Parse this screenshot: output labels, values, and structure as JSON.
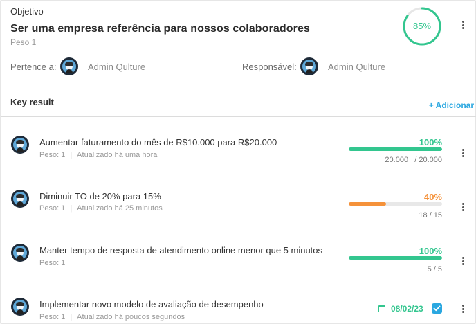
{
  "objective": {
    "label": "Objetivo",
    "title": "Ser uma empresa referência para nossos colaboradores",
    "weight": "Peso 1",
    "progress_percent": 85,
    "progress_label": "85%",
    "belongs_label": "Pertence a:",
    "belongs_name": "Admin Qulture",
    "owner_label": "Responsável:",
    "owner_name": "Admin Qulture",
    "ring_color": "#33c68f"
  },
  "key_results_section": {
    "title": "Key result",
    "add_label": "+ Adicionar"
  },
  "key_results": [
    {
      "title": "Aumentar faturamento do mês de R$10.000 para R$20.000",
      "weight": "Peso: 1",
      "updated": "Atualizado há uma hora",
      "percent": 100,
      "percent_label": "100%",
      "progress_text": "20.000   / 20.000",
      "color": "#33c68f"
    },
    {
      "title": "Diminuir TO de 20% para 15%",
      "weight": "Peso: 1",
      "updated": "Atualizado há 25 minutos",
      "percent": 40,
      "percent_label": "40%",
      "progress_text": "18 / 15",
      "color": "#f5923a"
    },
    {
      "title": "Manter tempo de resposta de atendimento online menor que 5 minutos",
      "weight": "Peso: 1",
      "percent": 100,
      "percent_label": "100%",
      "progress_text": "5 / 5",
      "color": "#33c68f"
    },
    {
      "title": "Implementar novo modelo de avaliação de desempenho",
      "weight": "Peso: 1",
      "updated": "Atualizado há poucos segundos",
      "date": "08/02/23",
      "checked": true,
      "color": "#33c68f"
    }
  ]
}
